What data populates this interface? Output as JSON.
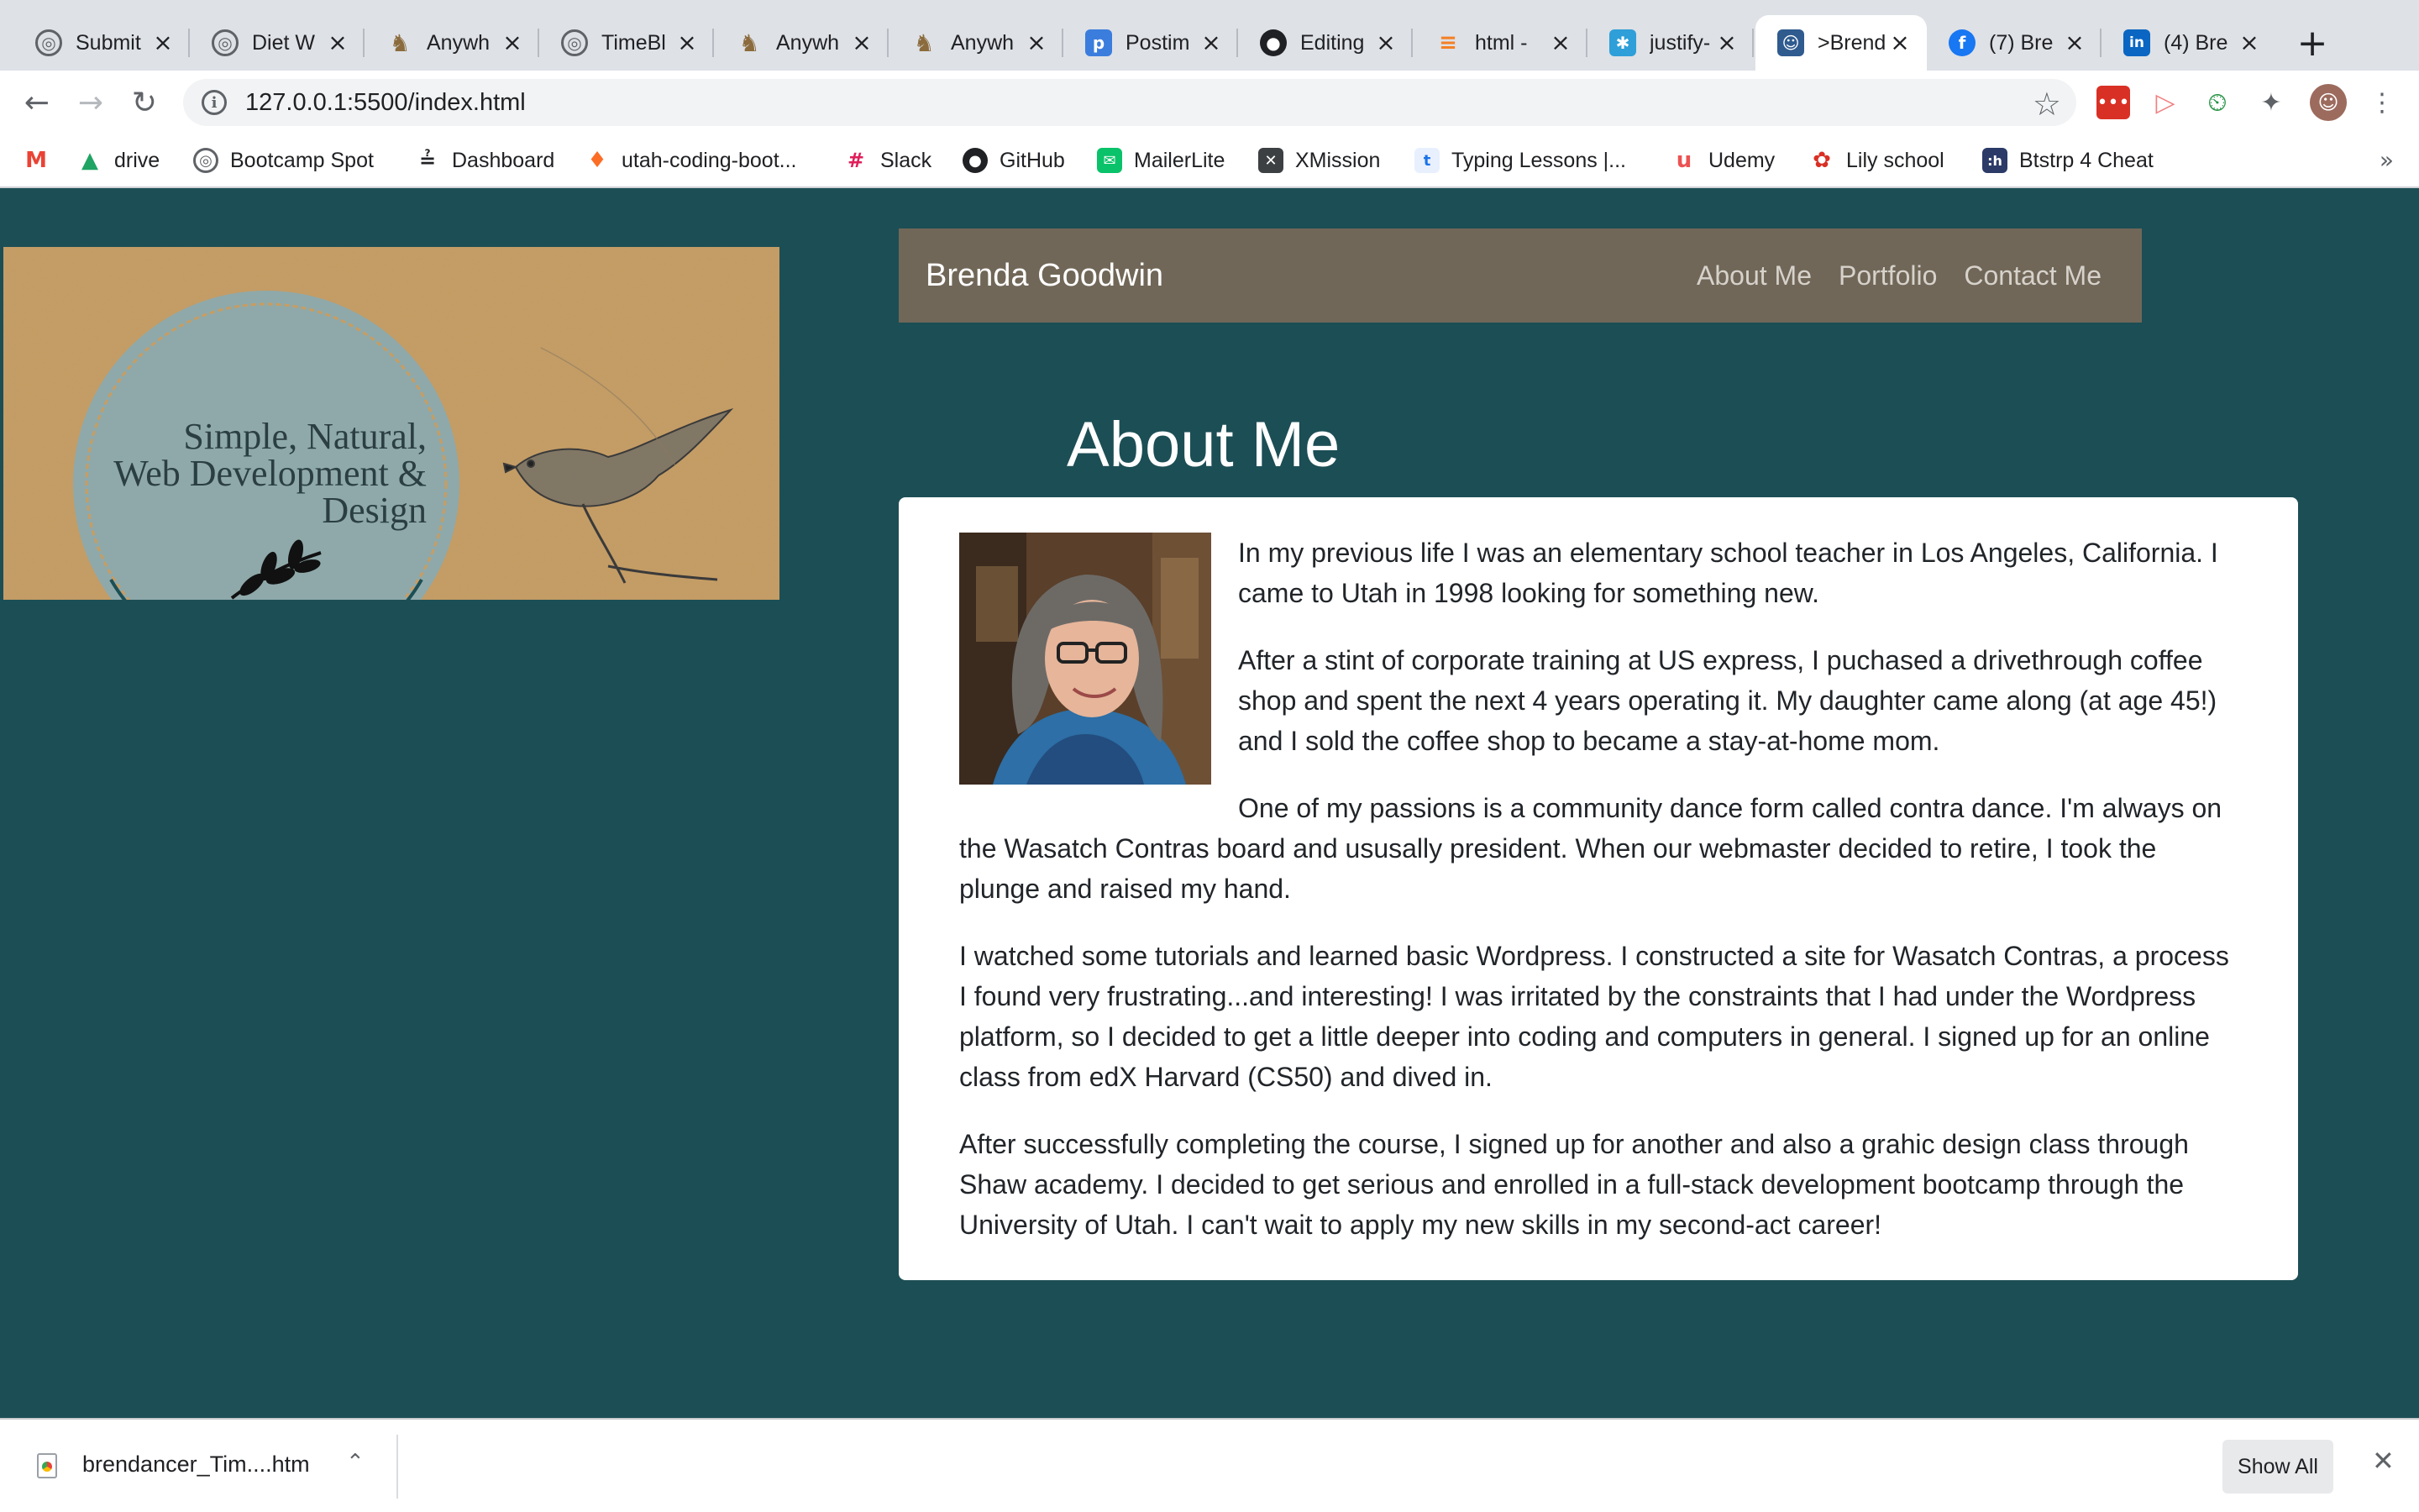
{
  "browser": {
    "tabs": [
      {
        "title": "Submit",
        "icon": "globe-icon",
        "color": "#5f6368"
      },
      {
        "title": "Diet W",
        "icon": "globe-icon",
        "color": "#5f6368"
      },
      {
        "title": "Anywh",
        "icon": "moose-icon",
        "color": "#8b6b3d"
      },
      {
        "title": "TimeBl",
        "icon": "globe-icon",
        "color": "#5f6368"
      },
      {
        "title": "Anywh",
        "icon": "moose-icon",
        "color": "#8b6b3d"
      },
      {
        "title": "Anywh",
        "icon": "moose-icon",
        "color": "#8b6b3d"
      },
      {
        "title": "Postim",
        "icon": "postimages-icon",
        "color": "#3b7ddd"
      },
      {
        "title": "Editing",
        "icon": "github-icon",
        "color": "#202124"
      },
      {
        "title": "html -",
        "icon": "stackoverflow-icon",
        "color": "#f48024"
      },
      {
        "title": "justify-",
        "icon": "css-tricks-icon",
        "color": "#2e9fd8"
      },
      {
        "title": ">Brend",
        "icon": "portrait-icon",
        "color": "#2f5b8f",
        "active": true
      },
      {
        "title": "(7) Bre",
        "icon": "facebook-icon",
        "color": "#1877f2"
      },
      {
        "title": "(4) Bre",
        "icon": "linkedin-icon",
        "color": "#0a66c2"
      }
    ],
    "new_tab_glyph": "+",
    "url": "127.0.0.1:5500/index.html",
    "bookmarks": [
      {
        "label": "",
        "icon": "gmail-icon",
        "color": "#ea4335"
      },
      {
        "label": "drive",
        "icon": "drive-icon",
        "color": "#1fa463"
      },
      {
        "label": "Bootcamp Spot",
        "icon": "globe-icon",
        "color": "#5f6368"
      },
      {
        "label": "Dashboard",
        "icon": "dashboard-icon",
        "color": "#202124"
      },
      {
        "label": "utah-coding-boot...",
        "icon": "gitlab-icon",
        "color": "#fc6d26"
      },
      {
        "label": "Slack",
        "icon": "slack-icon",
        "color": "#e01e5a"
      },
      {
        "label": "GitHub",
        "icon": "github-icon",
        "color": "#202124"
      },
      {
        "label": "MailerLite",
        "icon": "mailerlite-icon",
        "color": "#09c269"
      },
      {
        "label": "XMission",
        "icon": "xmission-icon",
        "color": "#3c4043"
      },
      {
        "label": "Typing Lessons |...",
        "icon": "typing-icon",
        "color": "#1a73e8"
      },
      {
        "label": "Udemy",
        "icon": "udemy-icon",
        "color": "#ec5252"
      },
      {
        "label": "Lily school",
        "icon": "lily-icon",
        "color": "#d93025"
      },
      {
        "label": "Btstrp 4 Cheat",
        "icon": "hashnode-icon",
        "color": "#2b3a67"
      }
    ],
    "bookmarks_more": "»"
  },
  "site": {
    "logo": {
      "line1": "Simple, Natural,",
      "line2": "Web Development &",
      "line3": "Design"
    },
    "brand": "Brenda Goodwin",
    "nav": [
      "About Me",
      "Portfolio",
      "Contact Me"
    ],
    "about_title": "About Me",
    "paragraphs": [
      "In my previous life I was an elementary school teacher in Los Angeles, California. I came to Utah in 1998 looking for something new.",
      "After a stint of corporate training at US express, I puchased a drivethrough coffee shop and spent the next 4 years operating it. My daughter came along (at age 45!) and I sold the coffee shop to became a stay-at-home mom.",
      "One of my passions is a community dance form called contra dance. I'm always on the Wasatch Contras board and ususally president. When our webmaster decided to retire, I took the plunge and raised my hand.",
      "I watched some tutorials and learned basic Wordpress. I constructed a site for Wasatch Contras, a process I found very frustrating...and interesting! I was irritated by the constraints that I had under the Wordpress platform, so I decided to get a little deeper into coding and computers in general. I signed up for an online class from edX Harvard (CS50) and dived in.",
      "After successfully completing the course, I signed up for another and also a grahic design class through Shaw academy. I decided to get serious and enrolled in a full-stack development bootcamp through the University of Utah. I can't wait to apply my new skills in my second-act career!"
    ]
  },
  "downloads": {
    "file_name": "brendancer_Tim....htm",
    "show_all": "Show All"
  },
  "colors": {
    "page_bg": "#1c4e55",
    "navbar_bg": "#716758",
    "card_bg": "#ffffff",
    "logo_circle": "#8fa9aa",
    "logo_banner": "#c79d62"
  }
}
